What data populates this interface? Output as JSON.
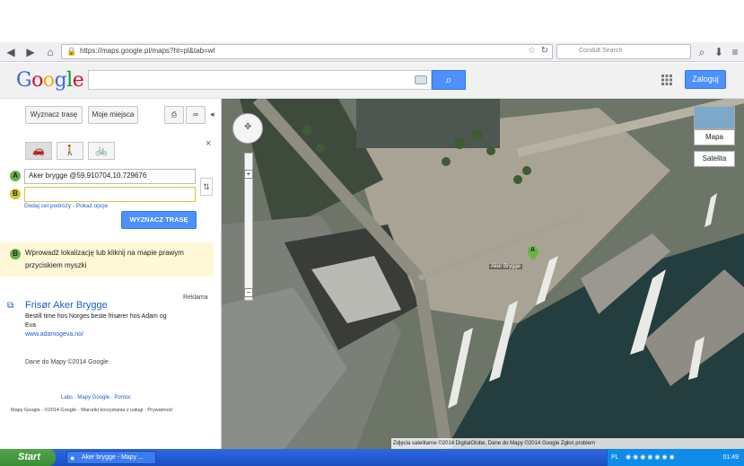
{
  "browser": {
    "url": "https://maps.google.pl/maps?hl=pl&tab=wl",
    "search_placeholder": "Condult Search"
  },
  "header": {
    "logo": "Google",
    "search_value": "",
    "signin_label": "Zaloguj"
  },
  "panel": {
    "route_tab": "Wyznacz trasę",
    "my_places_tab": "Moje miejsca",
    "collapse_glyph": "◂",
    "close_glyph": "×",
    "field_a": "Aker brygge @59.910704,10.729676",
    "field_b": "",
    "marker_a": "A",
    "marker_b": "B",
    "add_links": "Dodaj cel podróży - Pokaż opcje",
    "route_button": "WYZNACZ TRASĘ",
    "hint": "Wprowadź lokalizację lub kliknij na mapie prawym przyciskiem myszki",
    "ad_label": "Reklama",
    "ad_title": "Frisør Aker Brygge",
    "ad_desc": "Bestill time hos Norges beste frisører hos Adam og Eva",
    "ad_url": "www.adamogeva.no/",
    "map_data": "Dane do Mapy ©2014 Google",
    "footer_links": "Labs · Mapy Google · Pomoc",
    "footer_copy": "Mapy Google - ©2014 Google - Warunki korzystania z usługi - Prywatność"
  },
  "map": {
    "type_map": "Mapa",
    "type_satellite": "Satelita",
    "marker_label": "A",
    "place_label": "Aker Brygge",
    "attribution": "Zdjęcia satelitarne ©2014 DigitalGlobe, Dane do Mapy ©2014 Google   Zgłoś problem"
  },
  "taskbar": {
    "start": "Start",
    "task_label": "Aker brygge - Mapy ...",
    "lang": "PL",
    "clock": "01:49"
  }
}
